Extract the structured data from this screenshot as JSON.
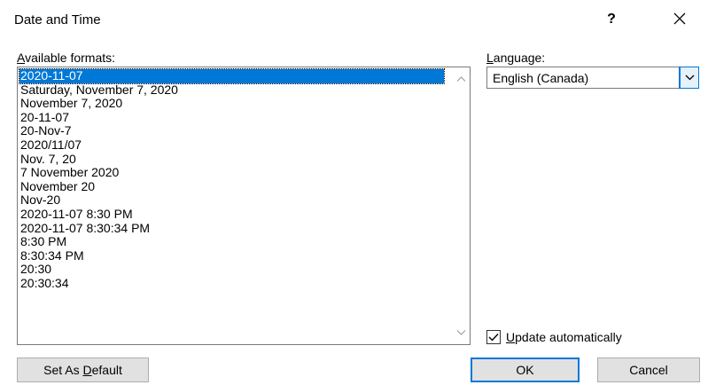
{
  "window": {
    "title": "Date and Time",
    "help_label": "?",
    "close_icon": "close-icon"
  },
  "formats": {
    "label_accel": "A",
    "label_rest": "vailable formats:",
    "items": [
      "2020-11-07",
      "Saturday, November 7, 2020",
      "November 7, 2020",
      "20-11-07",
      "20-Nov-7",
      "2020/11/07",
      "Nov. 7, 20",
      "7 November 2020",
      "November 20",
      "Nov-20",
      "2020-11-07 8:30 PM",
      "2020-11-07 8:30:34 PM",
      "8:30 PM",
      "8:30:34 PM",
      "20:30",
      "20:30:34"
    ],
    "selected_index": 0
  },
  "language": {
    "label_accel": "L",
    "label_rest": "anguage:",
    "value": "English (Canada)",
    "dropdown_icon": "chevron-down-icon"
  },
  "update": {
    "checked": true,
    "label_accel": "U",
    "label_rest": "pdate automatically"
  },
  "buttons": {
    "set_default_before": "Set As ",
    "set_default_accel": "D",
    "set_default_after": "efault",
    "ok": "OK",
    "cancel": "Cancel"
  },
  "colors": {
    "selection": "#0078d7",
    "button_face": "#e1e1e1",
    "focus_border": "#0078d7"
  }
}
